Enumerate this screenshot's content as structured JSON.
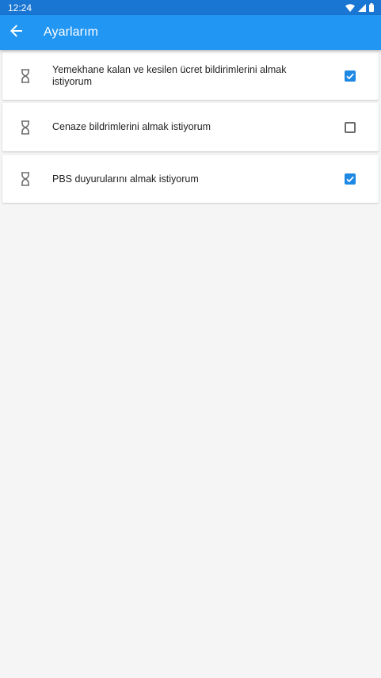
{
  "status_bar": {
    "time": "12:24",
    "icons": [
      "wifi-icon",
      "cell-signal-icon",
      "battery-icon"
    ]
  },
  "app_bar": {
    "title": "Ayarlarım",
    "back_icon": "arrow-back-icon"
  },
  "settings": [
    {
      "icon": "hourglass-icon",
      "label": "Yemekhane kalan ve kesilen ücret bildirimlerini almak istiyorum",
      "checked": true
    },
    {
      "icon": "hourglass-icon",
      "label": "Cenaze bildrimlerini almak istiyorum",
      "checked": false
    },
    {
      "icon": "hourglass-icon",
      "label": "PBS duyurularını almak istiyorum",
      "checked": true
    }
  ],
  "colors": {
    "status_bar": "#1976d2",
    "app_bar": "#2196f3",
    "checkbox_checked": "#1e88e5",
    "background": "#f5f5f5"
  }
}
